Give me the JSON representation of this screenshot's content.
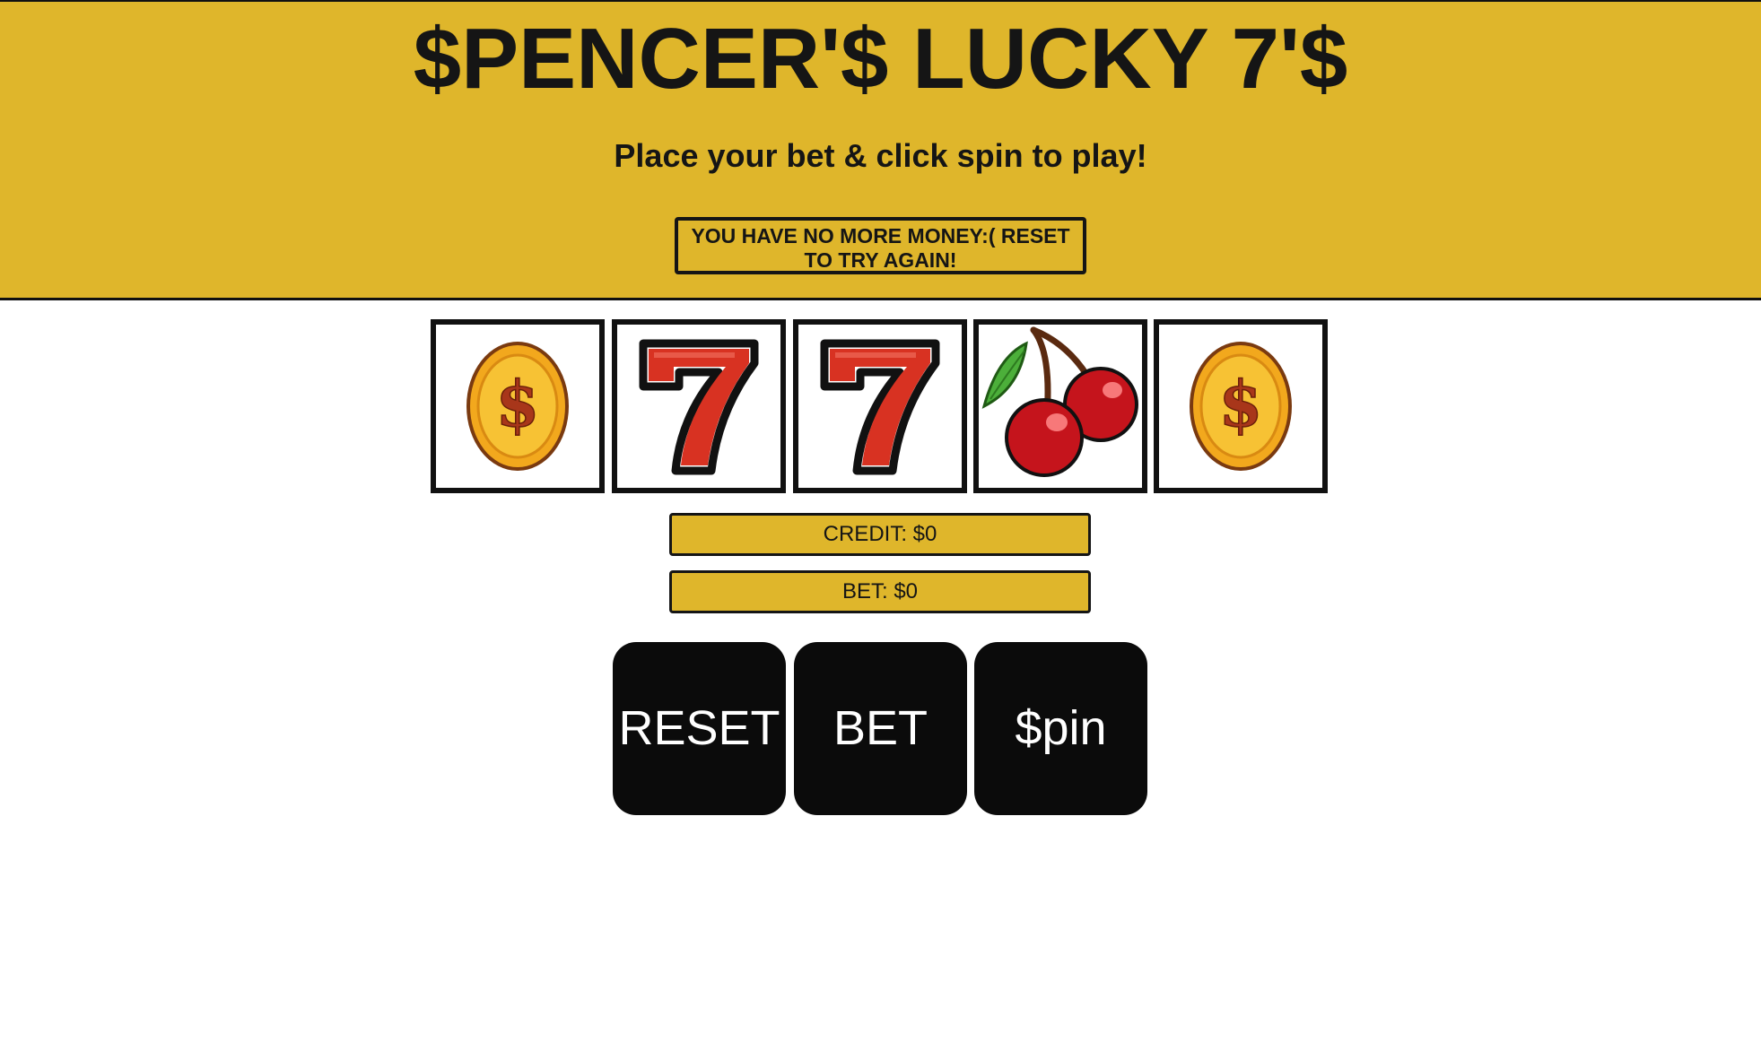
{
  "header": {
    "title": "$PENCER'$ LUCKY 7'$",
    "subtitle": "Place your bet & click spin to play!",
    "message": "YOU HAVE NO MORE MONEY:( RESET TO TRY AGAIN!"
  },
  "reels": [
    {
      "symbol": "coin-icon"
    },
    {
      "symbol": "seven-icon"
    },
    {
      "symbol": "seven-icon"
    },
    {
      "symbol": "cherry-icon"
    },
    {
      "symbol": "coin-icon"
    }
  ],
  "status": {
    "credit": "CREDIT: $0",
    "bet": "BET: $0"
  },
  "buttons": {
    "reset": "RESET",
    "bet": "BET",
    "spin": "$pin"
  },
  "colors": {
    "accent": "#dfb62b",
    "button": "#0b0b0b",
    "text": "#151515"
  }
}
